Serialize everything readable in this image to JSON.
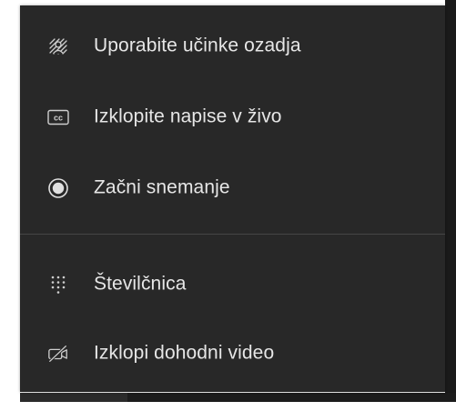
{
  "menu": {
    "items": [
      {
        "label": "Uporabite učinke ozadja",
        "icon": "background-effects-icon"
      },
      {
        "label": "Izklopite napise v živo",
        "icon": "closed-captions-icon"
      },
      {
        "label": "Začni snemanje",
        "icon": "record-icon"
      },
      {
        "label": "Številčnica",
        "icon": "dialpad-icon"
      },
      {
        "label": "Izklopi dohodni video",
        "icon": "video-off-icon"
      }
    ]
  },
  "colors": {
    "menu_background": "#282828",
    "text": "#e6e6e6",
    "icon": "#cfcfcf",
    "divider": "#464646"
  }
}
